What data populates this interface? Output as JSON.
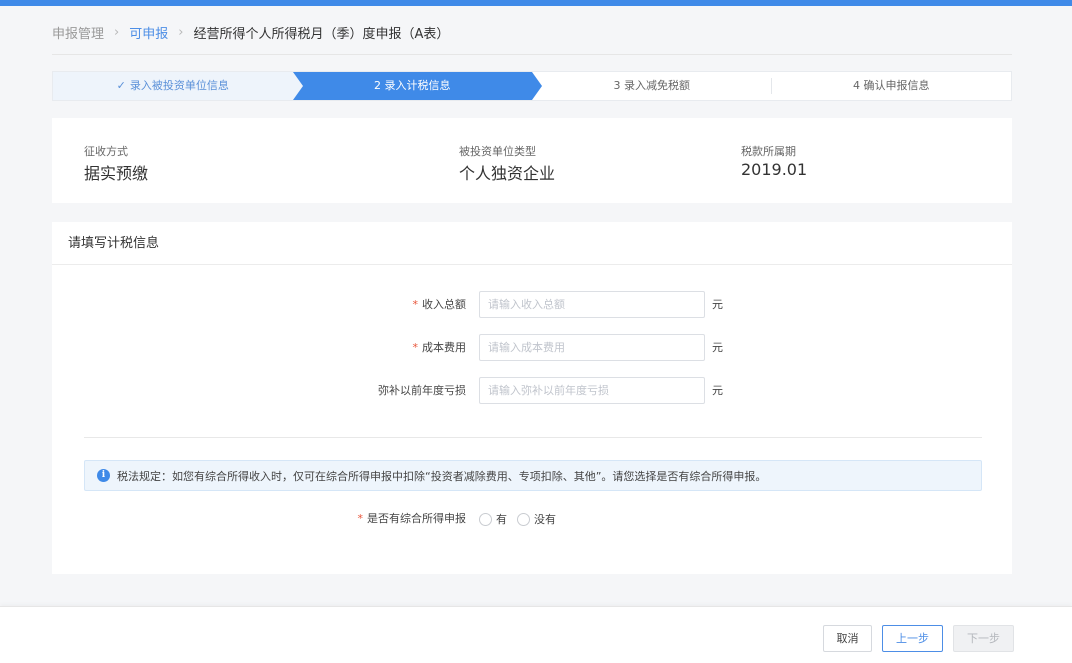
{
  "breadcrumb": {
    "items": [
      {
        "label": "申报管理"
      },
      {
        "label": "可申报"
      },
      {
        "label": "经营所得个人所得税月（季）度申报（A表）"
      }
    ],
    "separator": "›"
  },
  "steps": [
    {
      "label": "录入被投资单位信息",
      "status": "done"
    },
    {
      "label": "2 录入计税信息",
      "status": "active"
    },
    {
      "label": "3 录入减免税额",
      "status": "pending"
    },
    {
      "label": "4 确认申报信息",
      "status": "pending"
    }
  ],
  "info": {
    "collection_method": {
      "label": "征收方式",
      "value": "据实预缴"
    },
    "entity_type": {
      "label": "被投资单位类型",
      "value": "个人独资企业"
    },
    "tax_period": {
      "label": "税款所属期",
      "value": "2019.01"
    }
  },
  "form": {
    "title": "请填写计税信息",
    "fields": [
      {
        "label": "收入总额",
        "required": true,
        "placeholder": "请输入收入总额",
        "unit": "元",
        "value": ""
      },
      {
        "label": "成本费用",
        "required": true,
        "placeholder": "请输入成本费用",
        "unit": "元",
        "value": ""
      },
      {
        "label": "弥补以前年度亏损",
        "required": false,
        "placeholder": "请输入弥补以前年度亏损",
        "unit": "元",
        "value": ""
      }
    ],
    "required_mark": "*",
    "notice": "税法规定：如您有综合所得收入时，仅可在综合所得申报中扣除“投资者减除费用、专项扣除、其他”。请您选择是否有综合所得申报。",
    "radio": {
      "label": "是否有综合所得申报",
      "options": [
        "有",
        "没有"
      ]
    }
  },
  "footer": {
    "cancel_label": "取消",
    "prev_label": "上一步",
    "next_label": "下一步"
  },
  "colors": {
    "accent": "#3f8ae8",
    "required": "#e8553a"
  }
}
